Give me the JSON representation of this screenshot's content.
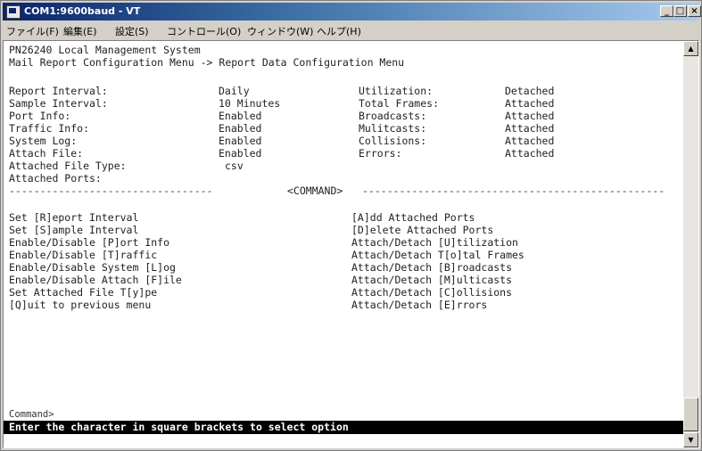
{
  "window": {
    "title": "COM1:9600baud - VT",
    "minimize_label": "_",
    "maximize_label": "□",
    "close_label": "×"
  },
  "menubar": {
    "items": [
      {
        "label": "ファイル(F)"
      },
      {
        "label": "編集(E)"
      },
      {
        "label": "設定(S)"
      },
      {
        "label": "コントロール(O)"
      },
      {
        "label": "ウィンドウ(W)"
      },
      {
        "label": "ヘルプ(H)"
      }
    ]
  },
  "terminal": {
    "header": {
      "line1": "PN26240 Local Management System",
      "line2": "Mail Report Configuration Menu -> Report Data Configuration Menu"
    },
    "settings_left": [
      {
        "label": "Report Interval:",
        "value": "Daily"
      },
      {
        "label": "Sample Interval:",
        "value": "10 Minutes"
      },
      {
        "label": "Port Info:",
        "value": "Enabled"
      },
      {
        "label": "Traffic Info:",
        "value": "Enabled"
      },
      {
        "label": "System Log:",
        "value": "Enabled"
      },
      {
        "label": "Attach File:",
        "value": "Enabled"
      },
      {
        "label": "Attached File Type:",
        "value": "csv"
      },
      {
        "label": "Attached Ports:",
        "value": ""
      }
    ],
    "settings_right": [
      {
        "label": "Utilization:",
        "value": "Detached"
      },
      {
        "label": "Total Frames:",
        "value": "Attached"
      },
      {
        "label": "Broadcasts:",
        "value": "Attached"
      },
      {
        "label": "Mulitcasts:",
        "value": "Attached"
      },
      {
        "label": "Collisions:",
        "value": "Attached"
      },
      {
        "label": "Errors:",
        "value": "Attached"
      }
    ],
    "divider_label": "<COMMAND>",
    "commands_left": [
      "Set [R]eport Interval",
      "Set [S]ample Interval",
      "Enable/Disable [P]ort Info",
      "Enable/Disable [T]raffic",
      "Enable/Disable System [L]og",
      "Enable/Disable Attach [F]ile",
      "Set Attached File T[y]pe",
      "[Q]uit to previous menu"
    ],
    "commands_right": [
      "[A]dd Attached Ports",
      "[D]elete Attached Ports",
      "Attach/Detach [U]tilization",
      "Attach/Detach T[o]tal Frames",
      "Attach/Detach [B]roadcasts",
      "Attach/Detach [M]ulticasts",
      "Attach/Detach [C]ollisions",
      "Attach/Detach [E]rrors"
    ],
    "prompt": "Command>",
    "status": "Enter the character in square brackets to select option"
  },
  "scrollbar": {
    "up_icon": "▲",
    "down_icon": "▼"
  }
}
